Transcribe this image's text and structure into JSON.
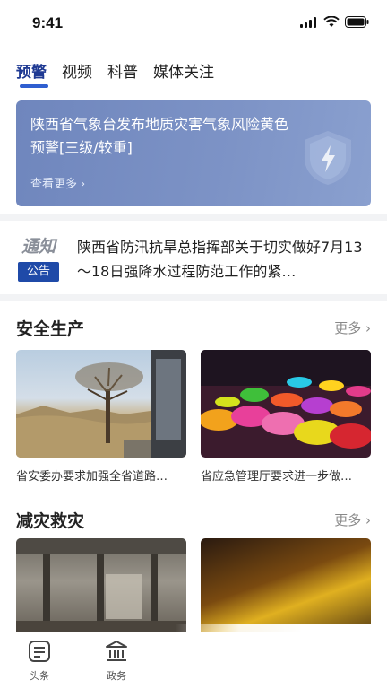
{
  "status_bar": {
    "time": "9:41"
  },
  "tabs": [
    {
      "label": "预警",
      "active": true
    },
    {
      "label": "视频",
      "active": false
    },
    {
      "label": "科普",
      "active": false
    },
    {
      "label": "媒体关注",
      "active": false
    }
  ],
  "alert": {
    "text": "陕西省气象台发布地质灾害气象风险黄色预警[三级/较重]",
    "more": "查看更多",
    "icon": "shield-lightning-icon"
  },
  "notice": {
    "logo_text": "通知",
    "badge": "公告",
    "text": "陕西省防汛抗旱总指挥部关于切实做好7月13～18日强降水过程防范工作的紧…"
  },
  "sections": [
    {
      "title": "安全生产",
      "more": "更多",
      "cards": [
        {
          "caption": "省安委办要求加强全省道路…",
          "image": "dry-landscape-tree"
        },
        {
          "caption": "省应急管理厅要求进一步做…",
          "image": "colored-powder-market"
        }
      ]
    },
    {
      "title": "减灾救灾",
      "more": "更多",
      "cards": [
        {
          "caption": "",
          "image": "damaged-building-interior"
        },
        {
          "caption": "",
          "image": "fire-glow"
        }
      ]
    }
  ],
  "bottom_nav": [
    {
      "label": "头条",
      "icon": "news-icon"
    },
    {
      "label": "政务",
      "icon": "government-building-icon"
    }
  ],
  "colors": {
    "accent": "#2f5fd0",
    "alert_bg": "#7d93c6",
    "badge": "#1f4aa8"
  }
}
